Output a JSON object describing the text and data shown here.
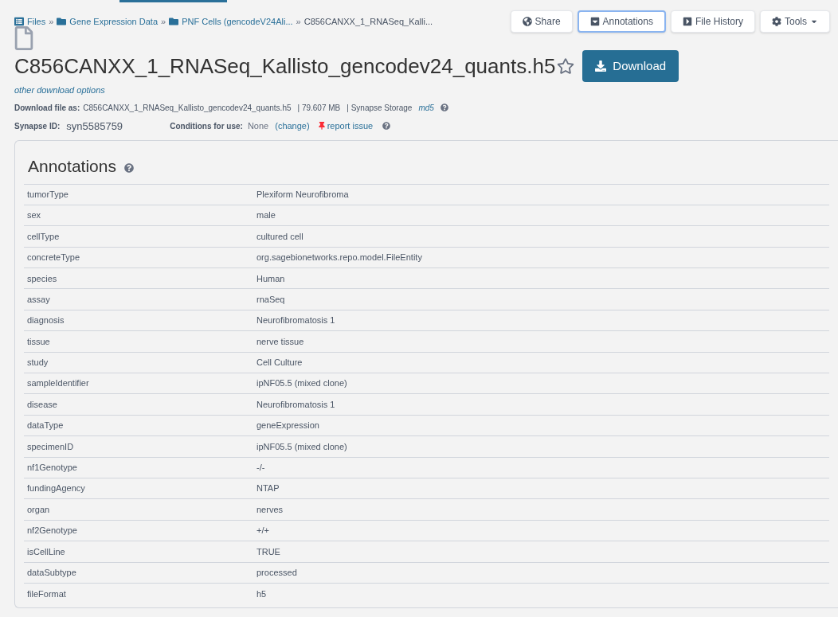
{
  "breadcrumb_separator": "»",
  "breadcrumbs": [
    {
      "label": "Files",
      "kind": "list"
    },
    {
      "label": "Gene Expression Data",
      "kind": "folder"
    },
    {
      "label": "PNF Cells (gencodeV24Ali...",
      "kind": "folder"
    },
    {
      "label": "C856CANXX_1_RNASeq_Kalli...",
      "kind": "current"
    }
  ],
  "toolbar": [
    {
      "label": "Share",
      "kind": "globe",
      "selected": false
    },
    {
      "label": "Annotations",
      "kind": "annotations",
      "selected": true
    },
    {
      "label": "File History",
      "kind": "history",
      "selected": false
    },
    {
      "label": "Tools",
      "kind": "tools",
      "selected": false
    }
  ],
  "title": "C856CANXX_1_RNASeq_Kallisto_gencodev24_quants.h5",
  "favorite": false,
  "download_button": "Download",
  "other_options": "other download options",
  "download_as": {
    "label": "Download file as:",
    "filename": "C856CANXX_1_RNASeq_Kallisto_gencodev24_quants.h5",
    "size": "| 79.607 MB",
    "storage": "| Synapse Storage",
    "md5": "md5"
  },
  "synapse_id": {
    "label": "Synapse ID:",
    "value": "syn5585759"
  },
  "conditions": {
    "label": "Conditions for use:",
    "value": "None",
    "change": "(change)",
    "report": "report issue"
  },
  "annotations": {
    "title": "Annotations",
    "rows": [
      {
        "key": "tumorType",
        "value": "Plexiform Neurofibroma"
      },
      {
        "key": "sex",
        "value": "male"
      },
      {
        "key": "cellType",
        "value": "cultured cell"
      },
      {
        "key": "concreteType",
        "value": "org.sagebionetworks.repo.model.FileEntity"
      },
      {
        "key": "species",
        "value": "Human"
      },
      {
        "key": "assay",
        "value": "rnaSeq"
      },
      {
        "key": "diagnosis",
        "value": "Neurofibromatosis 1"
      },
      {
        "key": "tissue",
        "value": "nerve tissue"
      },
      {
        "key": "study",
        "value": "Cell Culture"
      },
      {
        "key": "sampleIdentifier",
        "value": "ipNF05.5 (mixed clone)"
      },
      {
        "key": "disease",
        "value": "Neurofibromatosis 1"
      },
      {
        "key": "dataType",
        "value": "geneExpression"
      },
      {
        "key": "specimenID",
        "value": "ipNF05.5 (mixed clone)"
      },
      {
        "key": "nf1Genotype",
        "value": "-/-"
      },
      {
        "key": "fundingAgency",
        "value": "NTAP"
      },
      {
        "key": "organ",
        "value": "nerves"
      },
      {
        "key": "nf2Genotype",
        "value": "+/+"
      },
      {
        "key": "isCellLine",
        "value": "TRUE"
      },
      {
        "key": "dataSubtype",
        "value": "processed"
      },
      {
        "key": "fileFormat",
        "value": "h5"
      }
    ]
  }
}
